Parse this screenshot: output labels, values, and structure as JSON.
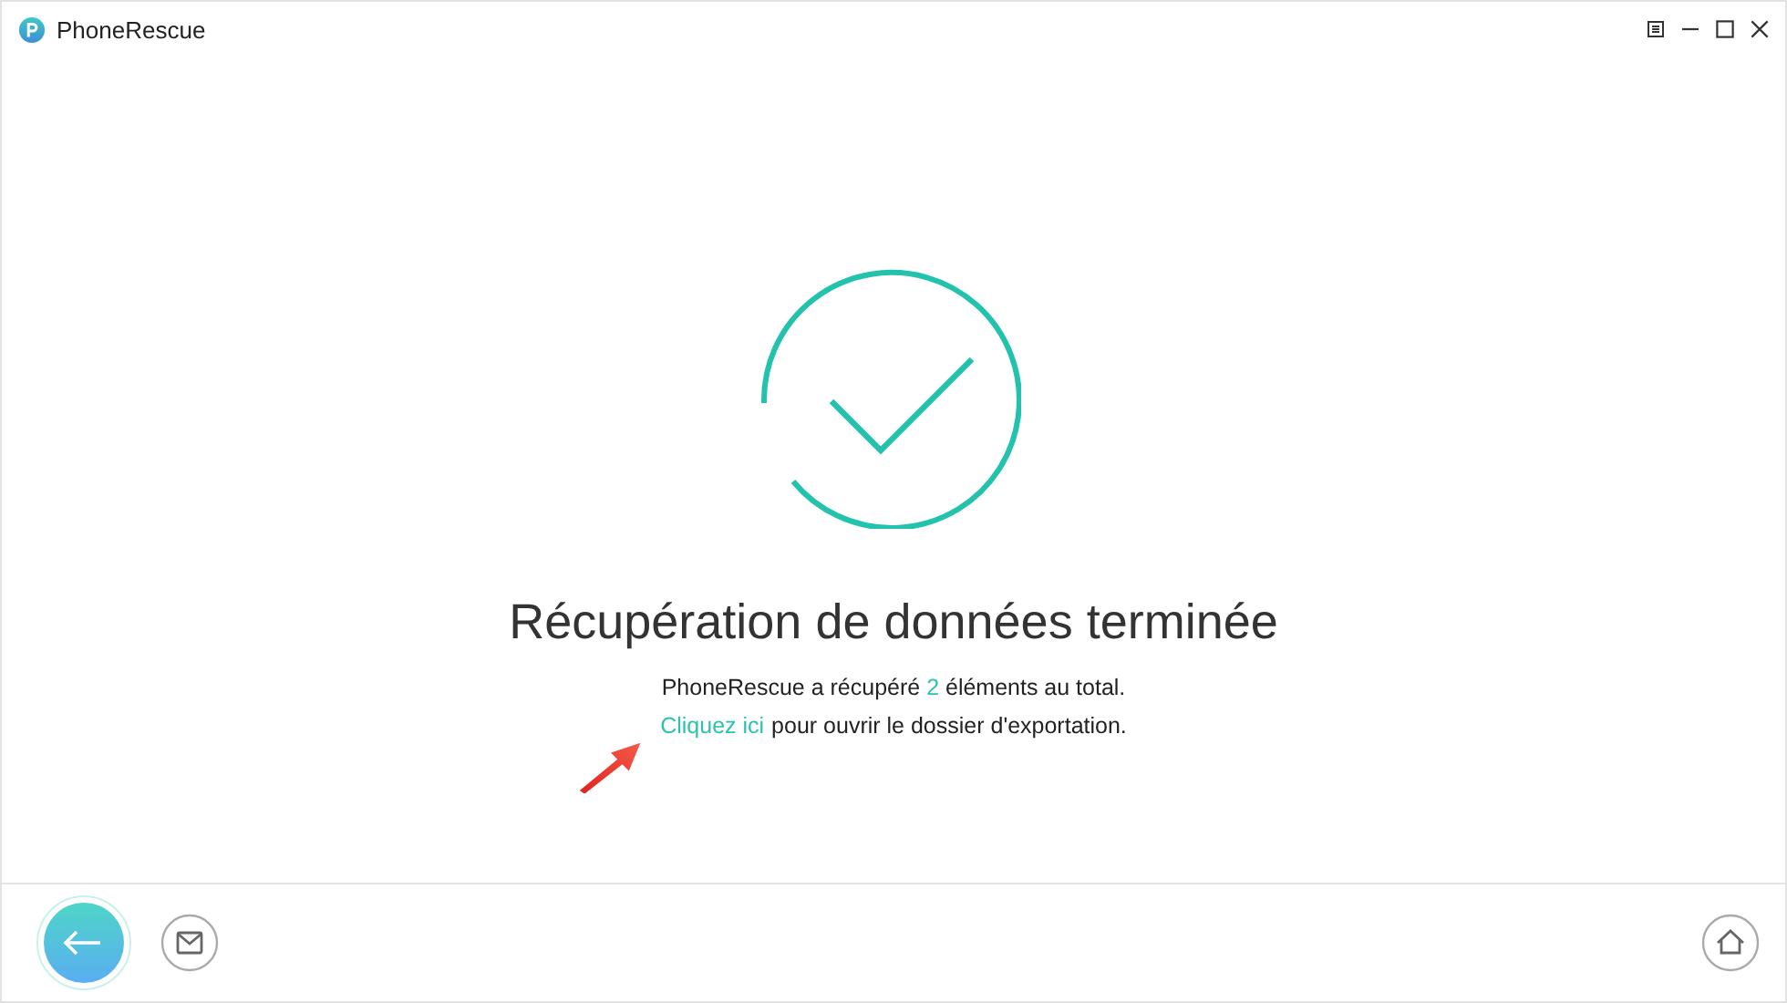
{
  "window": {
    "title": "PhoneRescue"
  },
  "result": {
    "heading": "Récupération de données terminée",
    "summary_before": "PhoneRescue a récupéré",
    "count": "2",
    "summary_after": "éléments au total.",
    "link": "Cliquez ici",
    "link_after": "pour ouvrir le dossier d'exportation."
  }
}
